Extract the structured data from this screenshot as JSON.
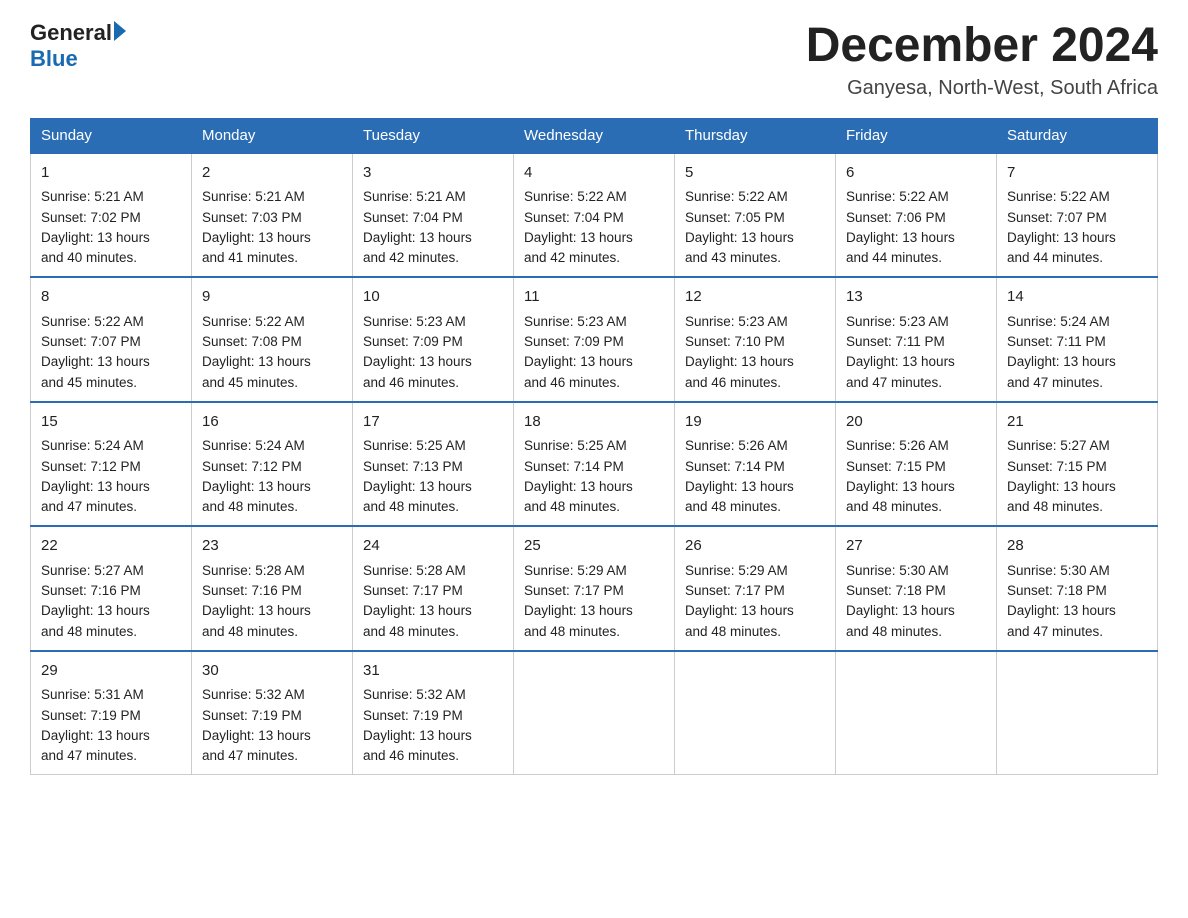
{
  "header": {
    "logo_general": "General",
    "logo_blue": "Blue",
    "title": "December 2024",
    "subtitle": "Ganyesa, North-West, South Africa"
  },
  "days_of_week": [
    "Sunday",
    "Monday",
    "Tuesday",
    "Wednesday",
    "Thursday",
    "Friday",
    "Saturday"
  ],
  "weeks": [
    [
      {
        "day": "1",
        "sunrise": "5:21 AM",
        "sunset": "7:02 PM",
        "daylight": "13 hours and 40 minutes."
      },
      {
        "day": "2",
        "sunrise": "5:21 AM",
        "sunset": "7:03 PM",
        "daylight": "13 hours and 41 minutes."
      },
      {
        "day": "3",
        "sunrise": "5:21 AM",
        "sunset": "7:04 PM",
        "daylight": "13 hours and 42 minutes."
      },
      {
        "day": "4",
        "sunrise": "5:22 AM",
        "sunset": "7:04 PM",
        "daylight": "13 hours and 42 minutes."
      },
      {
        "day": "5",
        "sunrise": "5:22 AM",
        "sunset": "7:05 PM",
        "daylight": "13 hours and 43 minutes."
      },
      {
        "day": "6",
        "sunrise": "5:22 AM",
        "sunset": "7:06 PM",
        "daylight": "13 hours and 44 minutes."
      },
      {
        "day": "7",
        "sunrise": "5:22 AM",
        "sunset": "7:07 PM",
        "daylight": "13 hours and 44 minutes."
      }
    ],
    [
      {
        "day": "8",
        "sunrise": "5:22 AM",
        "sunset": "7:07 PM",
        "daylight": "13 hours and 45 minutes."
      },
      {
        "day": "9",
        "sunrise": "5:22 AM",
        "sunset": "7:08 PM",
        "daylight": "13 hours and 45 minutes."
      },
      {
        "day": "10",
        "sunrise": "5:23 AM",
        "sunset": "7:09 PM",
        "daylight": "13 hours and 46 minutes."
      },
      {
        "day": "11",
        "sunrise": "5:23 AM",
        "sunset": "7:09 PM",
        "daylight": "13 hours and 46 minutes."
      },
      {
        "day": "12",
        "sunrise": "5:23 AM",
        "sunset": "7:10 PM",
        "daylight": "13 hours and 46 minutes."
      },
      {
        "day": "13",
        "sunrise": "5:23 AM",
        "sunset": "7:11 PM",
        "daylight": "13 hours and 47 minutes."
      },
      {
        "day": "14",
        "sunrise": "5:24 AM",
        "sunset": "7:11 PM",
        "daylight": "13 hours and 47 minutes."
      }
    ],
    [
      {
        "day": "15",
        "sunrise": "5:24 AM",
        "sunset": "7:12 PM",
        "daylight": "13 hours and 47 minutes."
      },
      {
        "day": "16",
        "sunrise": "5:24 AM",
        "sunset": "7:12 PM",
        "daylight": "13 hours and 48 minutes."
      },
      {
        "day": "17",
        "sunrise": "5:25 AM",
        "sunset": "7:13 PM",
        "daylight": "13 hours and 48 minutes."
      },
      {
        "day": "18",
        "sunrise": "5:25 AM",
        "sunset": "7:14 PM",
        "daylight": "13 hours and 48 minutes."
      },
      {
        "day": "19",
        "sunrise": "5:26 AM",
        "sunset": "7:14 PM",
        "daylight": "13 hours and 48 minutes."
      },
      {
        "day": "20",
        "sunrise": "5:26 AM",
        "sunset": "7:15 PM",
        "daylight": "13 hours and 48 minutes."
      },
      {
        "day": "21",
        "sunrise": "5:27 AM",
        "sunset": "7:15 PM",
        "daylight": "13 hours and 48 minutes."
      }
    ],
    [
      {
        "day": "22",
        "sunrise": "5:27 AM",
        "sunset": "7:16 PM",
        "daylight": "13 hours and 48 minutes."
      },
      {
        "day": "23",
        "sunrise": "5:28 AM",
        "sunset": "7:16 PM",
        "daylight": "13 hours and 48 minutes."
      },
      {
        "day": "24",
        "sunrise": "5:28 AM",
        "sunset": "7:17 PM",
        "daylight": "13 hours and 48 minutes."
      },
      {
        "day": "25",
        "sunrise": "5:29 AM",
        "sunset": "7:17 PM",
        "daylight": "13 hours and 48 minutes."
      },
      {
        "day": "26",
        "sunrise": "5:29 AM",
        "sunset": "7:17 PM",
        "daylight": "13 hours and 48 minutes."
      },
      {
        "day": "27",
        "sunrise": "5:30 AM",
        "sunset": "7:18 PM",
        "daylight": "13 hours and 48 minutes."
      },
      {
        "day": "28",
        "sunrise": "5:30 AM",
        "sunset": "7:18 PM",
        "daylight": "13 hours and 47 minutes."
      }
    ],
    [
      {
        "day": "29",
        "sunrise": "5:31 AM",
        "sunset": "7:19 PM",
        "daylight": "13 hours and 47 minutes."
      },
      {
        "day": "30",
        "sunrise": "5:32 AM",
        "sunset": "7:19 PM",
        "daylight": "13 hours and 47 minutes."
      },
      {
        "day": "31",
        "sunrise": "5:32 AM",
        "sunset": "7:19 PM",
        "daylight": "13 hours and 46 minutes."
      },
      null,
      null,
      null,
      null
    ]
  ],
  "labels": {
    "sunrise": "Sunrise:",
    "sunset": "Sunset:",
    "daylight": "Daylight:"
  }
}
